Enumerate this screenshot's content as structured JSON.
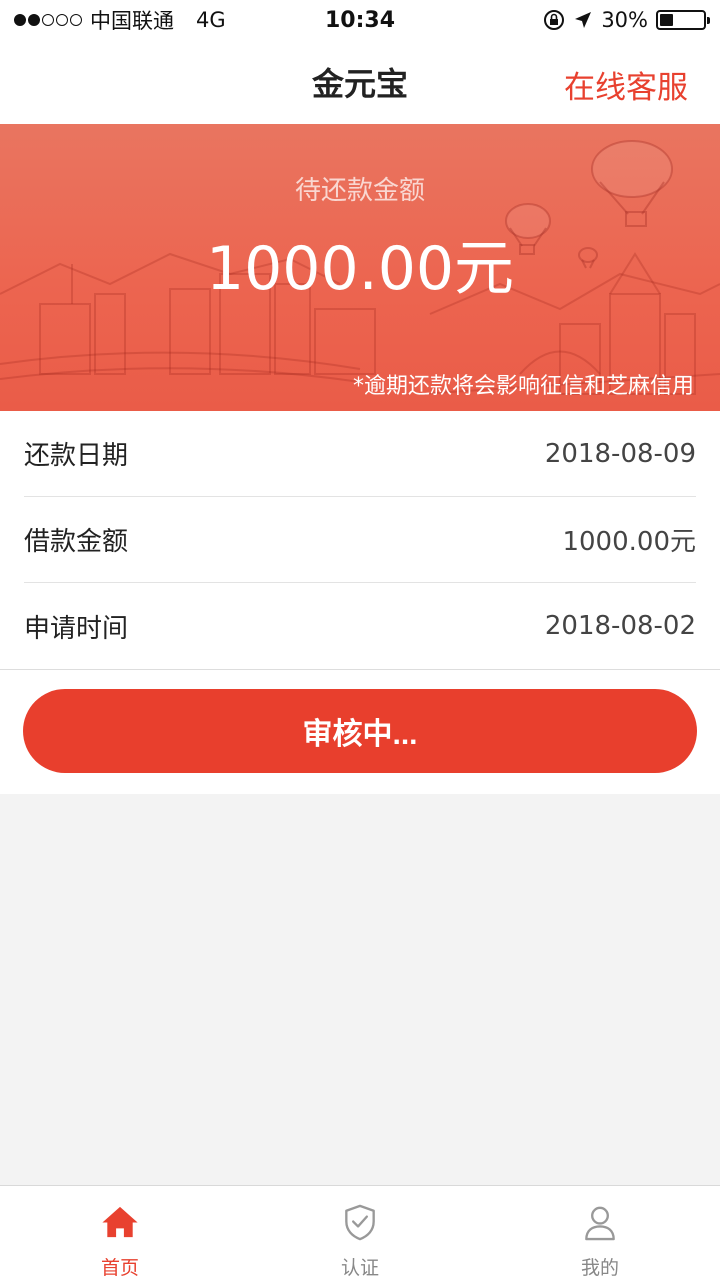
{
  "status_bar": {
    "carrier": "中国联通",
    "network": "4G",
    "time": "10:34",
    "battery": "30%",
    "battery_level": 0.3,
    "signal_bars_on": 2,
    "signal_bars_total": 5
  },
  "nav": {
    "title": "金元宝",
    "action": "在线客服"
  },
  "banner": {
    "label": "待还款金额",
    "amount": "1000.00元",
    "note": "*逾期还款将会影响征信和芝麻信用"
  },
  "info": [
    {
      "label": "还款日期",
      "value": "2018-08-09"
    },
    {
      "label": "借款金额",
      "value": "1000.00元"
    },
    {
      "label": "申请时间",
      "value": "2018-08-02"
    }
  ],
  "status_button": "审核中...",
  "tabs": [
    {
      "label": "首页",
      "icon": "home-icon",
      "active": true
    },
    {
      "label": "认证",
      "icon": "shield-check-icon",
      "active": false
    },
    {
      "label": "我的",
      "icon": "person-icon",
      "active": false
    }
  ],
  "colors": {
    "accent": "#e8412f",
    "banner": "#ec6550",
    "inactive": "#888888"
  }
}
